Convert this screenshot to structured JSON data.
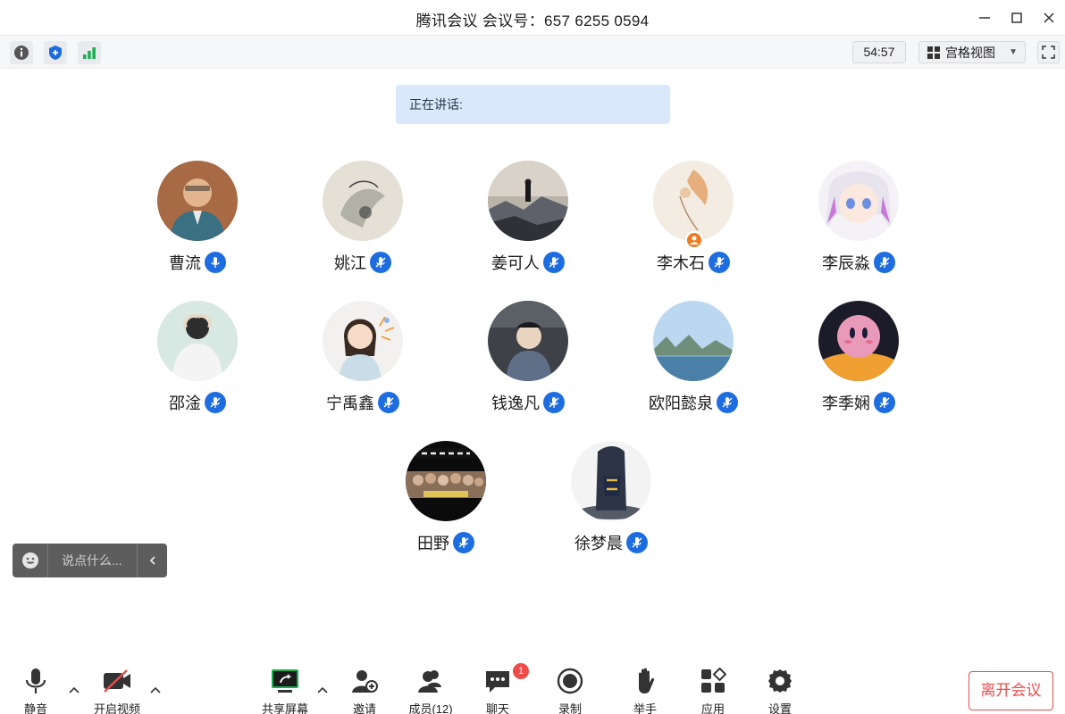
{
  "window": {
    "title": "腾讯会议 会议号：657 6255 0594"
  },
  "statusbar": {
    "timer": "54:57",
    "view_label": "宫格视图"
  },
  "speaking": {
    "label": "正在讲话:"
  },
  "participants": [
    {
      "name": "曹流"
    },
    {
      "name": "姚江"
    },
    {
      "name": "姜可人"
    },
    {
      "name": "李木石"
    },
    {
      "name": "李辰淼"
    },
    {
      "name": "邵淦"
    },
    {
      "name": "宁禹鑫"
    },
    {
      "name": "钱逸凡"
    },
    {
      "name": "欧阳懿泉"
    },
    {
      "name": "李季娴"
    },
    {
      "name": "田野"
    },
    {
      "name": "徐梦晨"
    }
  ],
  "chat": {
    "placeholder": "说点什么..."
  },
  "toolbar": {
    "mute": "静音",
    "video": "开启视频",
    "share": "共享屏幕",
    "invite": "邀请",
    "members": "成员(12)",
    "chat": "聊天",
    "chat_badge": "1",
    "record": "录制",
    "raise_hand": "举手",
    "apps": "应用",
    "settings": "设置",
    "leave": "离开会议"
  },
  "colors": {
    "accent": "#1e6de0",
    "leave": "#e84d4d",
    "speaking_bg": "#d9e8fb",
    "share_green": "#1aad52"
  }
}
